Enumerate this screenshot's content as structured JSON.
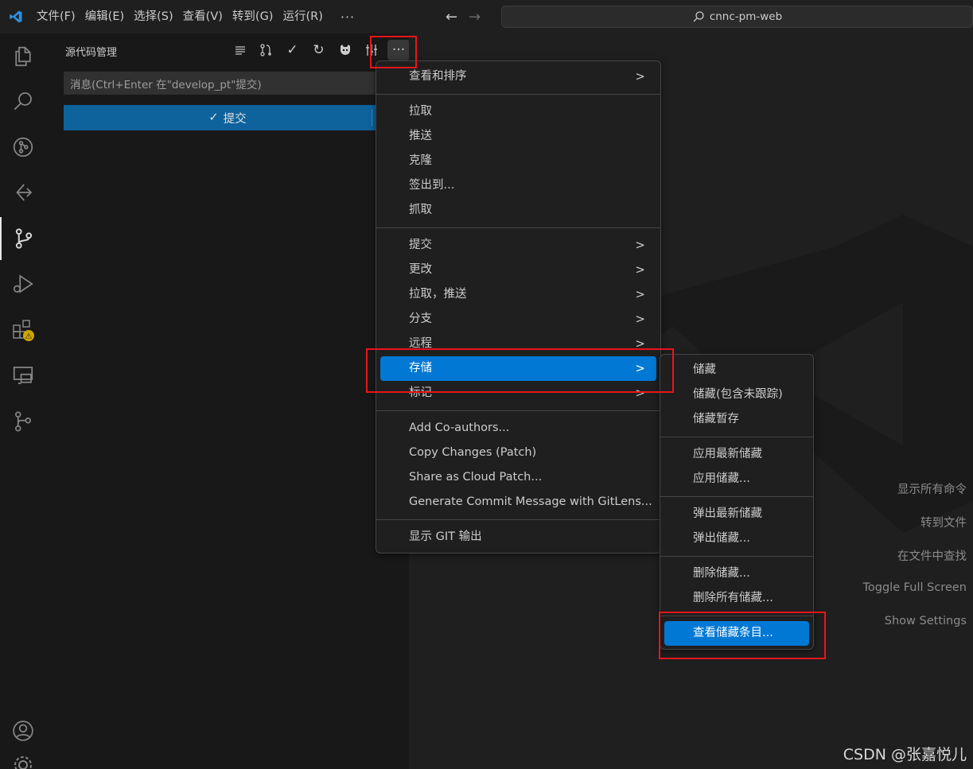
{
  "titlebar": {
    "menus": [
      "文件(F)",
      "编辑(E)",
      "选择(S)",
      "查看(V)",
      "转到(G)",
      "运行(R)"
    ],
    "more": "···",
    "search_text": "cnnc-pm-web"
  },
  "sidebar": {
    "title": "源代码管理",
    "message_placeholder": "消息(Ctrl+Enter 在\"develop_pt\"提交)",
    "commit_label": "提交",
    "more_label": "···"
  },
  "context_menu": {
    "items": [
      {
        "label": "查看和排序",
        "submenu": true
      },
      {
        "label": "拉取"
      },
      {
        "label": "推送"
      },
      {
        "label": "克隆"
      },
      {
        "label": "签出到..."
      },
      {
        "label": "抓取"
      },
      {
        "label": "提交",
        "submenu": true
      },
      {
        "label": "更改",
        "submenu": true
      },
      {
        "label": "拉取，推送",
        "submenu": true
      },
      {
        "label": "分支",
        "submenu": true
      },
      {
        "label": "远程",
        "submenu": true
      },
      {
        "label": "存储",
        "submenu": true,
        "highlighted": true
      },
      {
        "label": "标记",
        "submenu": true
      },
      {
        "label": "Add Co-authors..."
      },
      {
        "label": "Copy Changes (Patch)"
      },
      {
        "label": "Share as Cloud Patch..."
      },
      {
        "label": "Generate Commit Message with GitLens..."
      },
      {
        "label": "显示 GIT 输出"
      }
    ]
  },
  "stash_submenu": {
    "items": [
      {
        "label": "储藏"
      },
      {
        "label": "储藏(包含未跟踪)"
      },
      {
        "label": "储藏暂存"
      },
      {
        "label": "应用最新储藏"
      },
      {
        "label": "应用储藏..."
      },
      {
        "label": "弹出最新储藏"
      },
      {
        "label": "弹出储藏..."
      },
      {
        "label": "删除储藏..."
      },
      {
        "label": "删除所有储藏..."
      },
      {
        "label": "查看储藏条目...",
        "highlighted": true
      }
    ]
  },
  "editor_shortcuts": [
    "显示所有命令",
    "转到文件",
    "在文件中查找",
    "Toggle Full Screen",
    "Show Settings"
  ],
  "watermark_text": "CSDN @张嘉悦儿",
  "colors": {
    "accent": "#0078d4",
    "commit_button": "#0e639c",
    "annotation_red": "#e8151b",
    "warning_badge": "#cca700"
  }
}
